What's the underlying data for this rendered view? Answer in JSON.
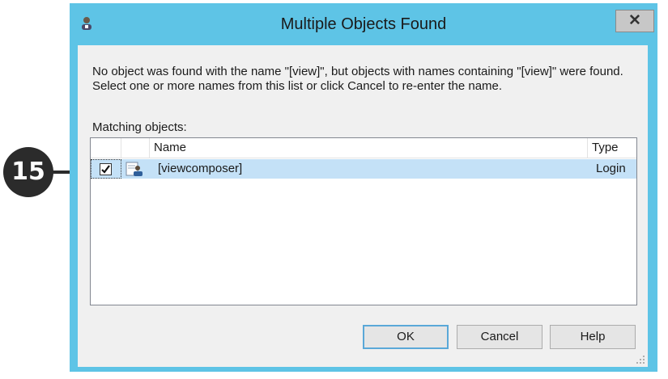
{
  "callout": {
    "number": "15"
  },
  "window": {
    "title": "Multiple Objects Found",
    "close_label": "✕"
  },
  "dialog": {
    "message": "No object was found with the name \"[view]\", but objects with names containing \"[view]\" were found.  Select one or more names from this list or click Cancel to re-enter the name.",
    "list_label": "Matching objects:",
    "columns": {
      "name": "Name",
      "type": "Type"
    },
    "rows": [
      {
        "checked": true,
        "name": "[viewcomposer]",
        "type": "Login",
        "icon": "login-user-icon"
      }
    ],
    "buttons": {
      "ok": "OK",
      "cancel": "Cancel",
      "help": "Help"
    }
  },
  "colors": {
    "frame": "#5ec4e6",
    "selection": "#c4e1f7",
    "callout": "#2b2b2b"
  }
}
